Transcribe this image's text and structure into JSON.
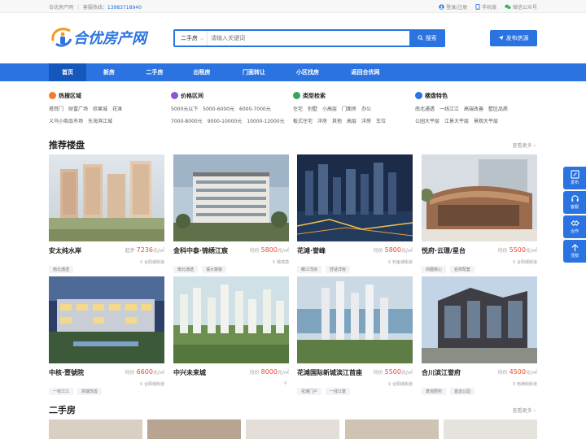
{
  "topbar": {
    "site_name": "合优房产网",
    "hotline_label": "客服热线：",
    "hotline_number": "13983718940",
    "login": "登录/注册",
    "mobile": "手机版",
    "wechat": "微信公众号"
  },
  "header": {
    "logo_text": "合优房产网",
    "search_category": "二手房",
    "search_placeholder": "请输入关键词",
    "search_button": "搜索",
    "publish_button": "发布房源"
  },
  "nav": [
    "首页",
    "新房",
    "二手房",
    "出租房",
    "门面转让",
    "小区找房",
    "返回合优网"
  ],
  "filters": [
    {
      "title": "热搜区域",
      "color": "#f07d2c",
      "lines": [
        [
          "塔耳门",
          "财富广场",
          "综果城",
          "花滩"
        ],
        [
          "义乌小商品市场",
          "东海滨江城"
        ]
      ]
    },
    {
      "title": "价格区间",
      "color": "#8a55d6",
      "lines": [
        [
          "5000元以下",
          "5000-6000元",
          "6000-7000元"
        ],
        [
          "7000-8000元",
          "9000-10000元",
          "10000-12000元"
        ]
      ]
    },
    {
      "title": "类型检索",
      "color": "#3aa35b",
      "lines": [
        [
          "住宅",
          "别墅",
          "小高层",
          "门面房",
          "办公"
        ],
        [
          "板式住宅",
          "洋房",
          "其他",
          "高层",
          "洋房",
          "车位"
        ]
      ]
    },
    {
      "title": "楼盘特色",
      "color": "#2a73e0",
      "lines": [
        [
          "南北通透",
          "一线江江",
          "高端改善",
          "墅区品质"
        ],
        [
          "公园大平层",
          "江景大平层",
          "景观大平层"
        ]
      ]
    }
  ],
  "recommend": {
    "title": "推荐楼盘",
    "more": "查看更多",
    "cards": [
      {
        "name": "安太纯水岸",
        "prefix": "起步",
        "price": "7236",
        "unit": "元/㎡",
        "tags": [
          "南北通透"
        ],
        "loc": "合阳城街道"
      },
      {
        "name": "金科中泰·锦绣江宸",
        "prefix": "均价",
        "price": "5800",
        "unit": "元/㎡",
        "tags": [
          "南北通透",
          "语大飘窗"
        ],
        "loc": "锦滨境"
      },
      {
        "name": "花滩·誉峰",
        "prefix": "均价",
        "price": "5800",
        "unit": "元/㎡",
        "tags": [
          "瞰江洋房",
          "舒适洋房"
        ],
        "loc": "钓鱼城街道"
      },
      {
        "name": "悦府·云璟/星台",
        "prefix": "均价",
        "price": "5500",
        "unit": "元/㎡",
        "tags": [
          "商圈核心",
          "名校配套"
        ],
        "loc": "合阳城街道"
      },
      {
        "name": "中核·壹號院",
        "prefix": "均价",
        "price": "6600",
        "unit": "元/㎡",
        "tags": [
          "一线江江",
          "高端改善"
        ],
        "loc": "合阳城街道"
      },
      {
        "name": "中兴未来城",
        "prefix": "均价",
        "price": "8000",
        "unit": "元/㎡",
        "tags": [],
        "loc": ""
      },
      {
        "name": "花滩国际新城滨江首座",
        "prefix": "均价",
        "price": "5500",
        "unit": "元/㎡",
        "tags": [
          "花滩门户",
          "一线江景"
        ],
        "loc": "合阳城街道"
      },
      {
        "name": "合川滨江誉府",
        "prefix": "均价",
        "price": "4500",
        "unit": "元/㎡",
        "tags": [
          "景观居所",
          "首选公园"
        ],
        "loc": "南津街街道"
      }
    ]
  },
  "secondhand": {
    "title": "二手房",
    "more": "查看更多"
  },
  "sidebar": [
    "发布",
    "客服",
    "合作",
    "顶部"
  ]
}
